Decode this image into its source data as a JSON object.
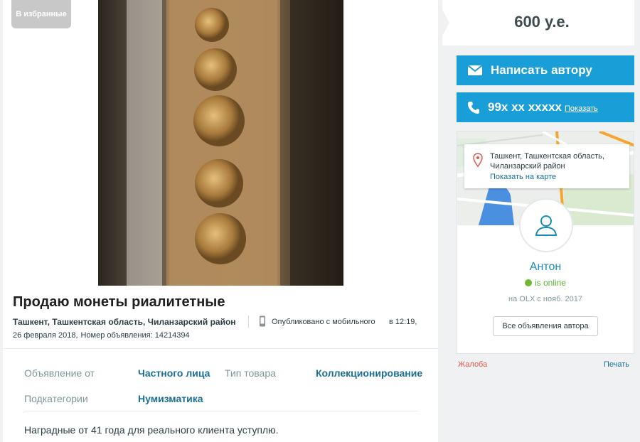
{
  "favorite_label": "В избранные",
  "ad": {
    "title": "Продаю монеты риалитетные",
    "location": "Ташкент, Ташкентская область, Чиланзарский район",
    "published": "Опубликовано с мобильного",
    "time": "в 12:19,",
    "date": "26 февраля 2018,",
    "ad_number": "Номер объявления: 14214394",
    "description": "Наградные от 41 года для реального клиента уступлю."
  },
  "params": [
    {
      "label": "Объявление от",
      "value": "Частного лица"
    },
    {
      "label": "Тип товара",
      "value": "Коллекционирование"
    },
    {
      "label": "Подкатегории",
      "value": "Нумизматика"
    }
  ],
  "price": "600 у.е.",
  "buttons": {
    "message": "Написать автору",
    "phone": "99x xx xxxxx",
    "show": "Показать"
  },
  "map": {
    "address": "Ташкент, Ташкентская область, Чиланзарский район",
    "show_on_map": "Показать на карте"
  },
  "user": {
    "name": "Антон",
    "status": "is online",
    "since": "на OLX с нояб. 2017",
    "all_ads": "Все объявления автора"
  },
  "footer": {
    "complaint": "Жалоба",
    "print": "Печать"
  },
  "colors": {
    "accent": "#1a9ed7",
    "link": "#1a6f94",
    "online": "#6fb82f",
    "complaint": "#e05a4f"
  }
}
